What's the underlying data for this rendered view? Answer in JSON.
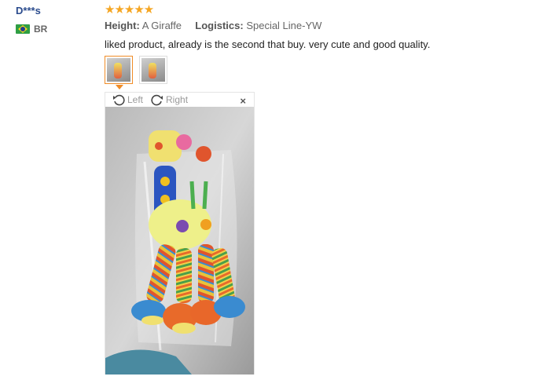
{
  "reviewer": {
    "name": "D***s",
    "country_code": "BR",
    "flag_icon": "brazil-flag-icon"
  },
  "review": {
    "stars_display": "★★★★★",
    "rating": 5,
    "height_label": "Height:",
    "height_value": "A Giraffe",
    "logistics_label": "Logistics:",
    "logistics_value": "Special Line-YW",
    "text": "liked product, already is the second that buy. very cute and good quality."
  },
  "viewer": {
    "rotate_left_label": "Left",
    "rotate_right_label": "Right",
    "close_glyph": "×"
  },
  "colors": {
    "star": "#f5a623",
    "name": "#2a4b8d",
    "active_thumb": "#f08c28"
  }
}
